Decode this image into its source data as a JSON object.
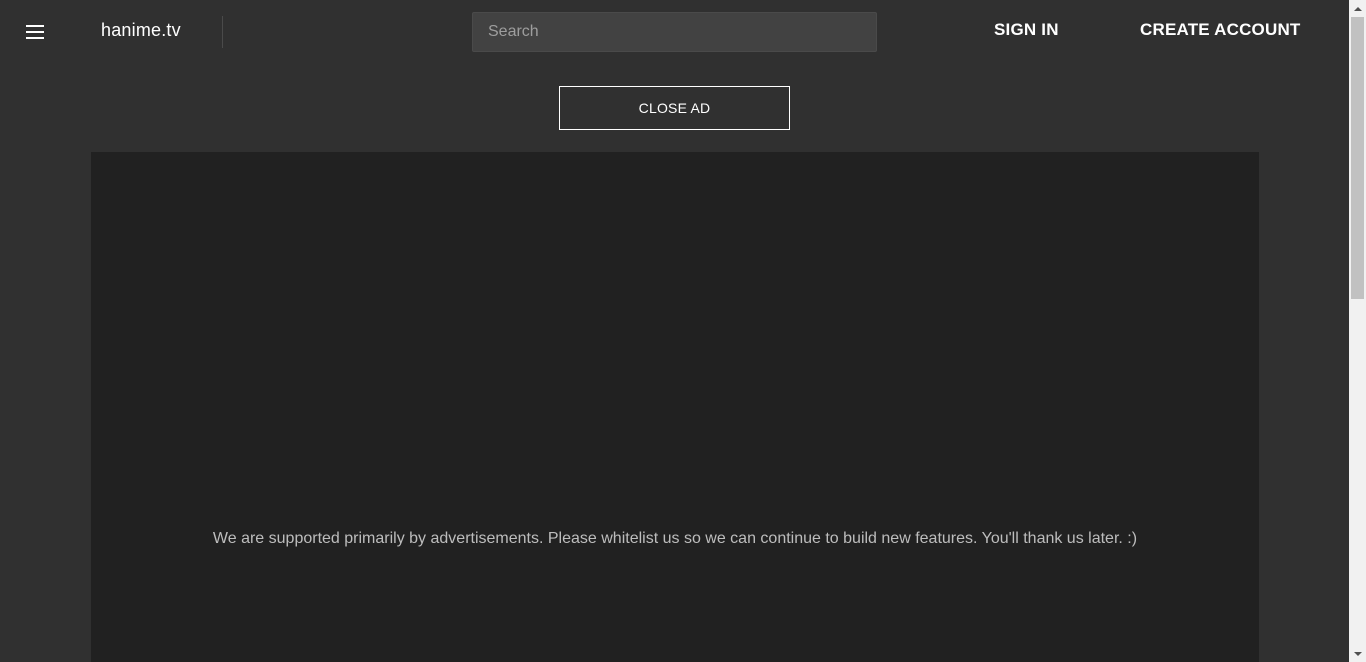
{
  "header": {
    "logo": "hanime.tv",
    "search_placeholder": "Search",
    "search_value": "",
    "sign_in_label": "SIGN IN",
    "create_account_label": "CREATE ACCOUNT"
  },
  "ad": {
    "close_label": "CLOSE AD",
    "message": "We are supported primarily by advertisements. Please whitelist us so we can continue to build new features. You'll thank us later. :)"
  },
  "icons": {
    "menu": "hamburger-menu-icon",
    "scroll_up": "arrow-up-icon",
    "scroll_down": "arrow-down-icon"
  },
  "colors": {
    "background": "#303030",
    "ad_panel": "#212121",
    "text": "#ffffff",
    "muted_text": "#bdbdbd",
    "search_bg": "#424242"
  }
}
